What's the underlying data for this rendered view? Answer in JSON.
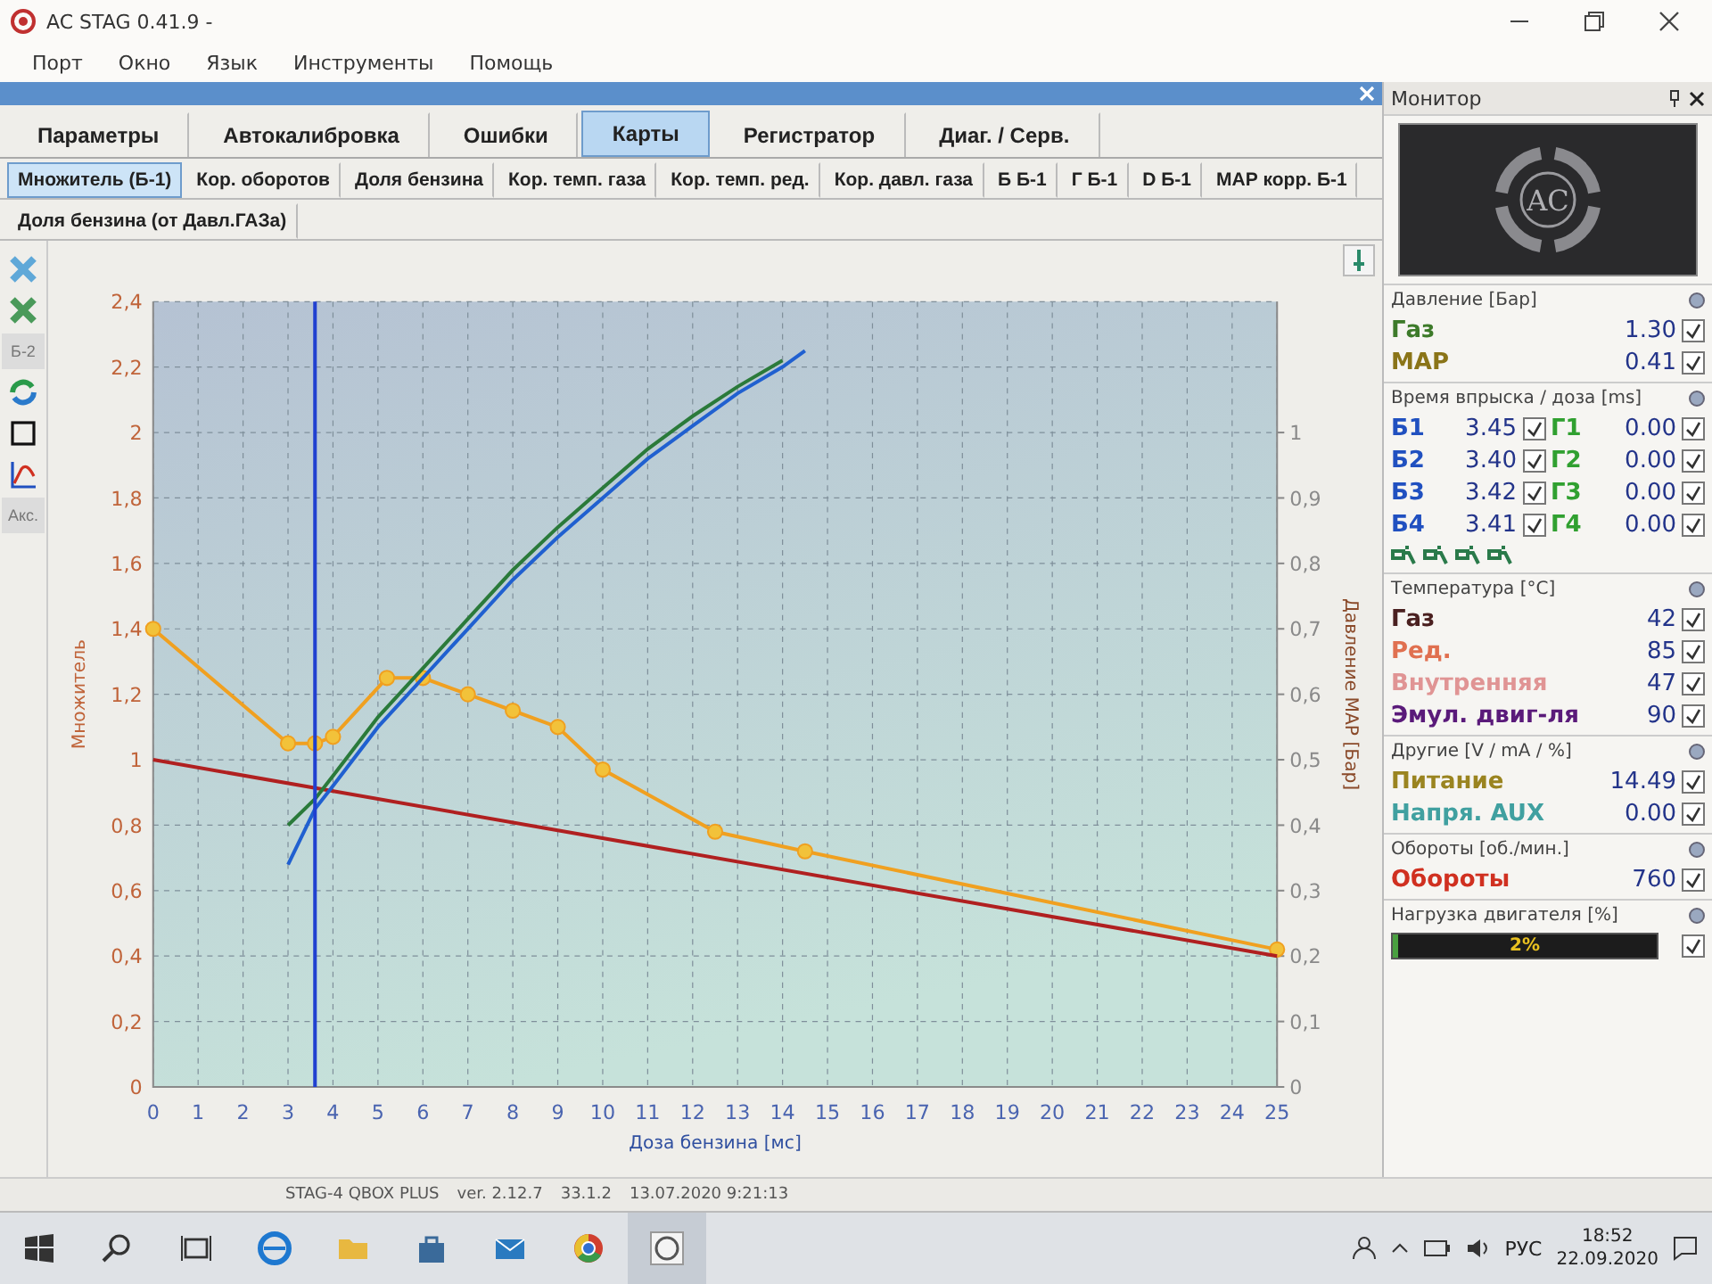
{
  "window": {
    "title": "AC STAG 0.41.9 -"
  },
  "menu": [
    "Порт",
    "Окно",
    "Язык",
    "Инструменты",
    "Помощь"
  ],
  "tabs": [
    {
      "label": "Параметры",
      "selected": false
    },
    {
      "label": "Автокалибровка",
      "selected": false
    },
    {
      "label": "Ошибки",
      "selected": false
    },
    {
      "label": "Карты",
      "selected": true
    },
    {
      "label": "Регистратор",
      "selected": false
    },
    {
      "label": "Диаг. / Серв.",
      "selected": false
    }
  ],
  "map_tab_rows": [
    {
      "tabs": [
        {
          "label": "Множитель (Б-1)",
          "selected": true
        },
        {
          "label": "Кор. оборотов",
          "selected": false
        },
        {
          "label": "Доля бензина",
          "selected": false
        },
        {
          "label": "Кор. темп. газа",
          "selected": false
        },
        {
          "label": "Кор. темп. ред.",
          "selected": false
        },
        {
          "label": "Кор. давл. газа",
          "selected": false
        },
        {
          "label": "Б Б-1",
          "selected": false
        },
        {
          "label": "Г Б-1",
          "selected": false
        },
        {
          "label": "D Б-1",
          "selected": false
        },
        {
          "label": "МАР корр. Б-1",
          "selected": false
        }
      ]
    },
    {
      "tabs": [
        {
          "label": "Доля бензина (от Давл.ГАЗа)",
          "selected": false
        }
      ]
    }
  ],
  "toolbar_labels": [
    "Б-2",
    "Акс."
  ],
  "chart_data": {
    "type": "line",
    "grid": true,
    "xlabel": "Доза бензина [мс]",
    "ylabel": "Множитель",
    "y2label": "Давление MAP [Бар]",
    "xlim": [
      0,
      25
    ],
    "ylim": [
      0,
      2.4
    ],
    "y2lim": [
      0,
      1.2
    ],
    "xticks": [
      0,
      1,
      2,
      3,
      4,
      5,
      6,
      7,
      8,
      9,
      10,
      11,
      12,
      13,
      14,
      15,
      16,
      17,
      18,
      19,
      20,
      21,
      22,
      23,
      24,
      25
    ],
    "yticks": [
      {
        "value": 0,
        "label": "0"
      },
      {
        "value": 0.2,
        "label": "0,2"
      },
      {
        "value": 0.4,
        "label": "0,4"
      },
      {
        "value": 0.6,
        "label": "0,6"
      },
      {
        "value": 0.8,
        "label": "0,8"
      },
      {
        "value": 1,
        "label": "1"
      },
      {
        "value": 1.2,
        "label": "1,2"
      },
      {
        "value": 1.4,
        "label": "1,4"
      },
      {
        "value": 1.6,
        "label": "1,6"
      },
      {
        "value": 1.8,
        "label": "1,8"
      },
      {
        "value": 2,
        "label": "2"
      },
      {
        "value": 2.2,
        "label": "2,2"
      },
      {
        "value": 2.4,
        "label": "2,4"
      }
    ],
    "y2ticks": [
      {
        "value": 0,
        "label": "0"
      },
      {
        "value": 0.1,
        "label": "0,1"
      },
      {
        "value": 0.2,
        "label": "0,2"
      },
      {
        "value": 0.3,
        "label": "0,3"
      },
      {
        "value": 0.4,
        "label": "0,4"
      },
      {
        "value": 0.5,
        "label": "0,5"
      },
      {
        "value": 0.6,
        "label": "0,6"
      },
      {
        "value": 0.7,
        "label": "0,7"
      },
      {
        "value": 0.8,
        "label": "0,8"
      },
      {
        "value": 0.9,
        "label": "0,9"
      },
      {
        "value": 1,
        "label": "1"
      }
    ],
    "series": [
      {
        "color": "#f0a020",
        "marker": "circle",
        "x": [
          0,
          3,
          3.6,
          4,
          5.2,
          6,
          7,
          8,
          9,
          10,
          12.5,
          14.5,
          25
        ],
        "values": [
          1.4,
          1.05,
          1.05,
          1.07,
          1.25,
          1.25,
          1.2,
          1.15,
          1.1,
          0.97,
          0.78,
          0.72,
          0.42
        ]
      },
      {
        "color": "#b02020",
        "x": [
          0,
          25
        ],
        "values": [
          1.0,
          0.4
        ]
      },
      {
        "color": "#2a7a3a",
        "x": [
          3,
          3.6,
          4,
          5,
          6,
          7,
          8,
          9,
          10,
          11,
          12,
          13,
          14
        ],
        "values": [
          0.8,
          0.88,
          0.95,
          1.13,
          1.28,
          1.43,
          1.58,
          1.71,
          1.83,
          1.95,
          2.05,
          2.14,
          2.22
        ]
      },
      {
        "color": "#2060d0",
        "x": [
          3,
          3.6,
          4,
          5,
          6,
          7,
          8,
          9,
          10,
          11,
          12,
          13,
          14,
          14.5
        ],
        "values": [
          0.68,
          0.85,
          0.92,
          1.1,
          1.25,
          1.4,
          1.55,
          1.68,
          1.8,
          1.92,
          2.02,
          2.12,
          2.2,
          2.25
        ]
      }
    ],
    "ref_lines": [
      {
        "axis": "x",
        "value": 3.6,
        "color": "#2040d0"
      }
    ]
  },
  "monitor": {
    "title": "Монитор",
    "logo_text": "AC",
    "sections": [
      {
        "kind": "values",
        "title": "Давление [Бар]",
        "rows": [
          {
            "label": "Газ",
            "value": "1.30",
            "checked": true,
            "color": "#3d7a2a"
          },
          {
            "label": "MAP",
            "value": "0.41",
            "checked": true,
            "color": "#8a7418"
          }
        ]
      },
      {
        "kind": "injection",
        "title": "Время впрыска / доза [ms]",
        "rows": [
          {
            "petrol": {
              "label": "Б1",
              "value": "3.45",
              "checked": true
            },
            "gas": {
              "label": "Г1",
              "value": "0.00",
              "checked": true
            }
          },
          {
            "petrol": {
              "label": "Б2",
              "value": "3.40",
              "checked": true
            },
            "gas": {
              "label": "Г2",
              "value": "0.00",
              "checked": true
            }
          },
          {
            "petrol": {
              "label": "Б3",
              "value": "3.42",
              "checked": true
            },
            "gas": {
              "label": "Г3",
              "value": "0.00",
              "checked": true
            }
          },
          {
            "petrol": {
              "label": "Б4",
              "value": "3.41",
              "checked": true
            },
            "gas": {
              "label": "Г4",
              "value": "0.00",
              "checked": true
            }
          }
        ]
      },
      {
        "kind": "values",
        "title": "Температура [°C]",
        "rows": [
          {
            "label": "Газ",
            "value": "42",
            "checked": true,
            "color": "#4a2020"
          },
          {
            "label": "Ред.",
            "value": "85",
            "checked": true,
            "color": "#e07050"
          },
          {
            "label": "Внутренняя",
            "value": "47",
            "checked": true,
            "color": "#e09494"
          },
          {
            "label": "Эмул. двиг-ля",
            "value": "90",
            "checked": true,
            "color": "#5a1a7a"
          }
        ]
      },
      {
        "kind": "values",
        "title": "Другие [V / mA / %]",
        "rows": [
          {
            "label": "Питание",
            "value": "14.49",
            "checked": true,
            "color": "#9a8420"
          },
          {
            "label": "Напря. AUX",
            "value": "0.00",
            "checked": true,
            "color": "#40a0a0"
          }
        ]
      },
      {
        "kind": "values",
        "title": "Обороты [об./мин.]",
        "rows": [
          {
            "label": "Обороты",
            "value": "760",
            "checked": true,
            "color": "#d03020"
          }
        ]
      },
      {
        "kind": "load",
        "title": "Нагрузка двигателя [%]",
        "level": 0.02,
        "reading": "2%",
        "checked": true
      }
    ]
  },
  "status_bar": {
    "device": "STAG-4 QBOX PLUS",
    "version": "ver. 2.12.7",
    "firmware": "33.1.2",
    "date": "13.07.2020 9:21:13"
  },
  "taskbar": {
    "language": "РУС",
    "time": "18:52",
    "date": "22.09.2020"
  }
}
